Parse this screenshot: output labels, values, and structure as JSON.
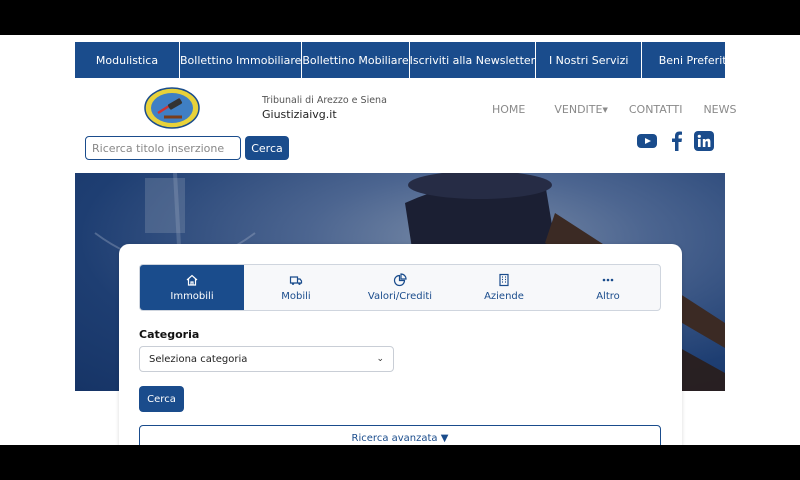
{
  "top_nav": [
    "Modulistica",
    "Bollettino Immobiliare",
    "Bollettino Mobiliare",
    "Iscriviti alla Newsletter",
    "I Nostri Servizi",
    "Beni Preferiti"
  ],
  "brand": {
    "subtitle": "Tribunali di Arezzo e Siena",
    "name": "Giustiziaivg.it"
  },
  "main_nav": {
    "home": "HOME",
    "vendite": "VENDITE",
    "contatti": "CONTATTI",
    "news": "NEWS"
  },
  "search": {
    "placeholder": "Ricerca titolo inserzione",
    "button": "Cerca"
  },
  "social_icons": [
    "youtube-icon",
    "facebook-icon",
    "linkedin-icon"
  ],
  "colors": {
    "primary": "#1a4c8c",
    "youtube": "#1a4c8c"
  },
  "tabs": [
    {
      "label": "Immobili",
      "icon": "house-icon",
      "active": true
    },
    {
      "label": "Mobili",
      "icon": "truck-icon",
      "active": false
    },
    {
      "label": "Valori/Crediti",
      "icon": "pie-chart-icon",
      "active": false
    },
    {
      "label": "Aziende",
      "icon": "building-icon",
      "active": false
    },
    {
      "label": "Altro",
      "icon": "dots-icon",
      "active": false
    }
  ],
  "form": {
    "category_label": "Categoria",
    "category_select": "Seleziona categoria",
    "search_button": "Cerca",
    "advanced": "Ricerca avanzata ▼"
  }
}
